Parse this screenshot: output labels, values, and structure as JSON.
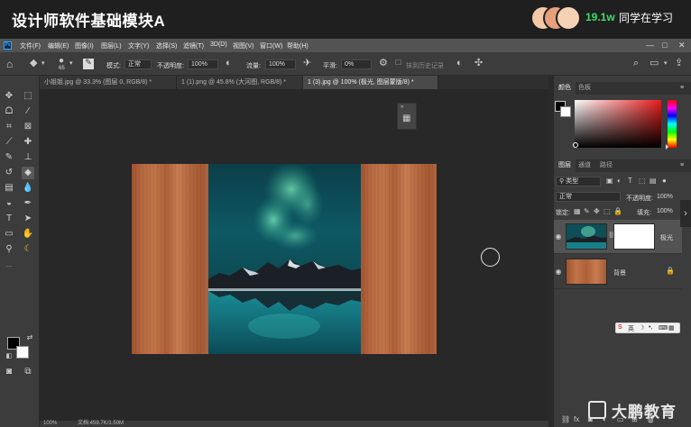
{
  "overlay": {
    "course_title": "设计师软件基础模块A",
    "learner_count": "19.1w",
    "learner_label": "同学在学习",
    "watermark": "大鹏教育"
  },
  "menubar": {
    "logo": "Ps",
    "items": [
      "文件(F)",
      "编辑(E)",
      "图像(I)",
      "图层(L)",
      "文字(Y)",
      "选择(S)",
      "滤镜(T)",
      "3D(D)",
      "视图(V)",
      "窗口(W)",
      "帮助(H)"
    ],
    "min": "—",
    "max": "□",
    "close": "✕"
  },
  "options": {
    "brush_size": "65",
    "mode_label": "模式:",
    "mode_value": "正常",
    "opacity_label": "不透明度:",
    "opacity_value": "100%",
    "flow_label": "流量:",
    "flow_value": "100%",
    "smooth_label": "平滑:",
    "smooth_value": "0%",
    "erase_history": "抹到历史记录"
  },
  "tabs": [
    {
      "label": "小姐姐.jpg @ 33.3% (图层 0, RGB/8) *",
      "active": false
    },
    {
      "label": "1 (1).png @ 45.8% (大河图, RGB/8) *",
      "active": false
    },
    {
      "label": "1 (3).jpg @ 100% (极光, 图层蒙版/8) *",
      "active": true
    }
  ],
  "status": {
    "zoom": "100%",
    "doc": "文档:459.7K/1.50M"
  },
  "color_panel": {
    "tabs": [
      "颜色",
      "色板"
    ]
  },
  "layers_panel": {
    "tabs": [
      "图层",
      "通道",
      "路径"
    ],
    "filter_kind": "类型",
    "blend_mode": "正常",
    "opacity_label": "不透明度:",
    "opacity_value": "100%",
    "lock_label": "锁定:",
    "fill_label": "填充:",
    "fill_value": "100%",
    "layers": [
      {
        "name": "极光",
        "visible": true,
        "selected": true,
        "has_mask": true
      },
      {
        "name": "背景",
        "visible": true,
        "selected": false,
        "locked": true
      }
    ]
  },
  "ime": {
    "label": "英"
  },
  "colors": {
    "accent_green": "#3fdc6a",
    "foreground": "#000000",
    "background": "#ffffff",
    "picked_hue": "#e61c1c"
  }
}
